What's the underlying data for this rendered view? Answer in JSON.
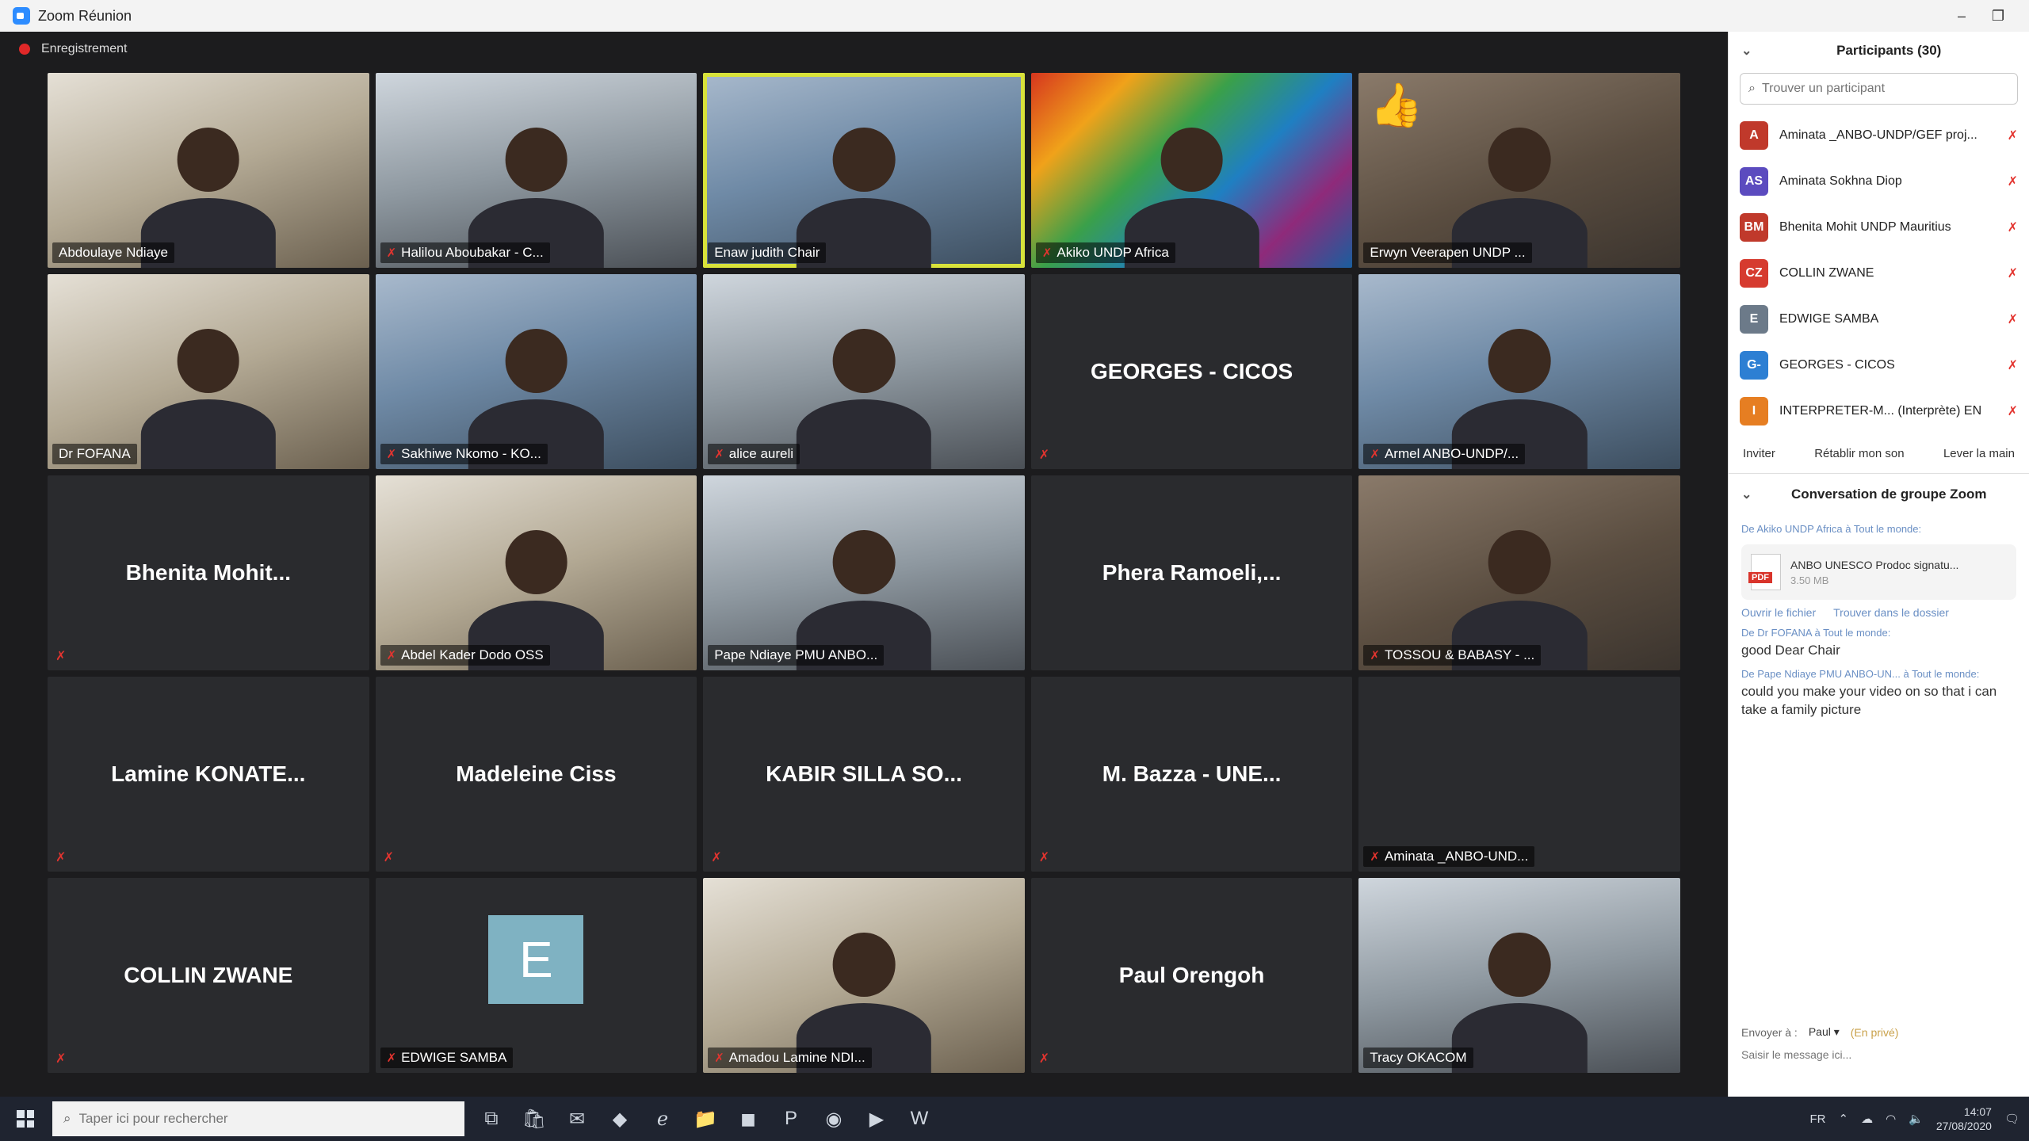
{
  "window": {
    "title": "Zoom Réunion",
    "minimize": "–",
    "restore": "❐"
  },
  "recording": {
    "label": "Enregistrement"
  },
  "tiles": [
    {
      "kind": "video",
      "variant": "v4",
      "name": "Abdoulaye Ndiaye",
      "muted": false
    },
    {
      "kind": "video",
      "variant": "v2",
      "name": "Halilou Aboubakar - C...",
      "muted": true
    },
    {
      "kind": "video",
      "variant": "v3",
      "name": "Enaw judith Chair",
      "muted": false,
      "active": true
    },
    {
      "kind": "video",
      "variant": "sdg",
      "name": "Akiko UNDP Africa",
      "muted": true
    },
    {
      "kind": "video",
      "variant": "v1",
      "name": "Erwyn Veerapen UNDP ...",
      "muted": false,
      "reaction": "👍"
    },
    {
      "kind": "video",
      "variant": "v4",
      "name": "Dr FOFANA",
      "muted": false
    },
    {
      "kind": "video",
      "variant": "v3",
      "name": "Sakhiwe Nkomo - KO...",
      "muted": true
    },
    {
      "kind": "video",
      "variant": "v2",
      "name": "alice aureli",
      "muted": true
    },
    {
      "kind": "name",
      "name": "GEORGES - CICOS",
      "muted": true
    },
    {
      "kind": "video",
      "variant": "v3",
      "name": "Armel ANBO-UNDP/...",
      "muted": true
    },
    {
      "kind": "name",
      "name": "Bhenita Mohit...",
      "muted": true
    },
    {
      "kind": "video",
      "variant": "v4",
      "name": "Abdel Kader Dodo OSS",
      "muted": true
    },
    {
      "kind": "video",
      "variant": "v2",
      "name": "Pape Ndiaye PMU ANBO...",
      "muted": false
    },
    {
      "kind": "name",
      "name": "Phera Ramoeli,...",
      "muted": false
    },
    {
      "kind": "video",
      "variant": "v1",
      "name": "TOSSOU & BABASY - ...",
      "muted": true
    },
    {
      "kind": "name",
      "name": "Lamine KONATE...",
      "muted": true
    },
    {
      "kind": "name",
      "name": "Madeleine Ciss",
      "muted": true
    },
    {
      "kind": "name",
      "name": "KABIR SILLA SO...",
      "muted": true
    },
    {
      "kind": "name",
      "name": "M. Bazza - UNE...",
      "muted": true
    },
    {
      "kind": "label-only",
      "name": "Aminata _ANBO-UND...",
      "muted": true
    },
    {
      "kind": "name",
      "name": "COLLIN ZWANE",
      "muted": true
    },
    {
      "kind": "avatar",
      "letter": "E",
      "name": "EDWIGE SAMBA",
      "muted": true
    },
    {
      "kind": "video",
      "variant": "v4",
      "name": "Amadou Lamine NDI...",
      "muted": true
    },
    {
      "kind": "name",
      "name": "Paul Orengoh",
      "muted": true
    },
    {
      "kind": "video",
      "variant": "v2",
      "name": "Tracy OKACOM",
      "muted": false
    }
  ],
  "participants_panel": {
    "title": "Participants (30)",
    "search_placeholder": "Trouver un participant",
    "items": [
      {
        "initials": "A",
        "color": "#c0392b",
        "name": "Aminata _ANBO-UNDP/GEF proj..."
      },
      {
        "initials": "AS",
        "color": "#5b4bbf",
        "name": "Aminata Sokhna Diop"
      },
      {
        "initials": "BM",
        "color": "#c0392b",
        "name": "Bhenita Mohit UNDP Mauritius"
      },
      {
        "initials": "CZ",
        "color": "#d63b2f",
        "name": "COLLIN ZWANE"
      },
      {
        "initials": "E",
        "color": "#6c7a89",
        "name": "EDWIGE SAMBA"
      },
      {
        "initials": "G-",
        "color": "#2d7fd3",
        "name": "GEORGES - CICOS"
      },
      {
        "initials": "I",
        "color": "#e67e22",
        "name": "INTERPRETER-M... (Interprète) EN"
      }
    ],
    "actions": {
      "invite": "Inviter",
      "unmute": "Rétablir mon son",
      "raise": "Lever la main"
    }
  },
  "chat": {
    "title": "Conversation de groupe Zoom",
    "messages": [
      {
        "meta": "De Akiko UNDP Africa à Tout le monde:",
        "file": {
          "badge": "PDF",
          "name": "ANBO UNESCO Prodoc signatu...",
          "size": "3.50 MB",
          "open": "Ouvrir le fichier",
          "show": "Trouver dans le dossier"
        }
      },
      {
        "meta": "De Dr FOFANA à Tout le monde:",
        "text": "good Dear Chair"
      },
      {
        "meta": "De Pape Ndiaye PMU ANBO-UN... à Tout le monde:",
        "text": "could you make your video on so that i can take a family picture"
      }
    ],
    "send_to_label": "Envoyer à :",
    "send_to_value": "Paul ▾",
    "private_label": "(En privé)",
    "input_placeholder": "Saisir le message ici..."
  },
  "taskbar": {
    "search_placeholder": "Taper ici pour rechercher",
    "apps": [
      {
        "name": "task-view-icon",
        "glyph": "⧉"
      },
      {
        "name": "store-icon",
        "glyph": "🛍"
      },
      {
        "name": "mail-icon",
        "glyph": "✉"
      },
      {
        "name": "dropbox-icon",
        "glyph": "◆"
      },
      {
        "name": "edge-icon",
        "glyph": "ℯ"
      },
      {
        "name": "folder-icon",
        "glyph": "📁"
      },
      {
        "name": "office-icon",
        "glyph": "◼"
      },
      {
        "name": "powerpoint-icon",
        "glyph": "P"
      },
      {
        "name": "chrome-icon",
        "glyph": "◉"
      },
      {
        "name": "zoom-icon",
        "glyph": "▶"
      },
      {
        "name": "word-icon",
        "glyph": "W"
      }
    ],
    "lang": "FR",
    "time": "14:07",
    "date": "27/08/2020"
  }
}
